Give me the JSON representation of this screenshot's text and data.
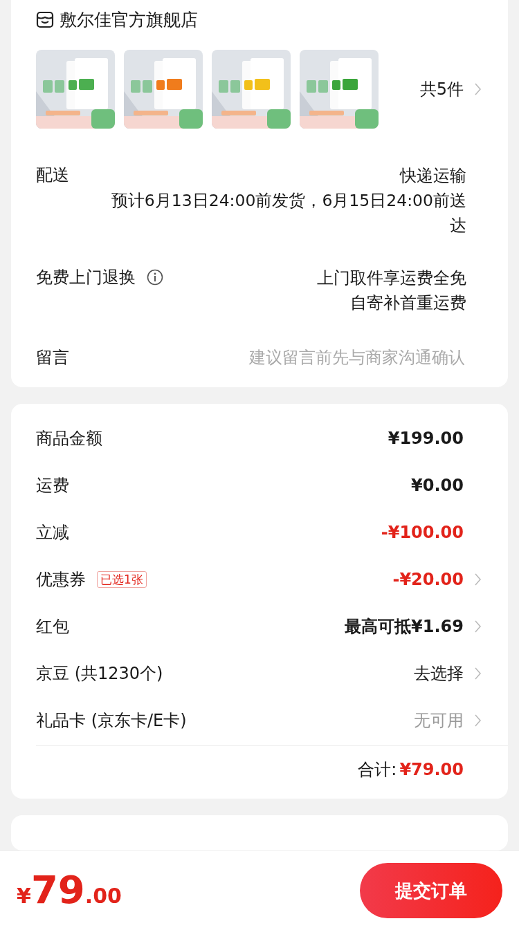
{
  "store": {
    "name": "敷尔佳官方旗舰店"
  },
  "products": {
    "count": "共5件"
  },
  "details": [
    {
      "label": "配送",
      "info_icon": false,
      "lines": [
        "快递运输",
        "预计6月13日24:00前发货，6月15日24:00前送达"
      ]
    },
    {
      "label": "免费上门退换",
      "info_icon": true,
      "lines": [
        "上门取件享运费全免",
        "自寄补首重运费"
      ]
    }
  ],
  "message": {
    "label": "留言",
    "placeholder": "建议留言前先与商家沟通确认"
  },
  "summary": [
    {
      "label": "商品金额",
      "value": "¥199.00",
      "kind": "strong",
      "arrow": false
    },
    {
      "label": "运费",
      "value": "¥0.00",
      "kind": "strong",
      "arrow": false
    },
    {
      "label": "立减",
      "value": "-¥100.00",
      "kind": "red",
      "arrow": false
    },
    {
      "label": "优惠券",
      "tag": "已选1张",
      "value": "-¥20.00",
      "kind": "red",
      "arrow": true
    },
    {
      "label": "红包",
      "value": "最高可抵¥1.69",
      "kind": "strong",
      "arrow": true
    },
    {
      "label": "京豆 (共1230个)",
      "value": "去选择",
      "kind": "normal",
      "arrow": true
    },
    {
      "label": "礼品卡 (京东卡/E卡)",
      "value": "无可用",
      "kind": "muted",
      "arrow": true
    }
  ],
  "total": {
    "label": "合计:",
    "value": "¥79.00"
  },
  "bottom_bar": {
    "currency": "¥",
    "integer": "79",
    "decimal": ".00",
    "submit": "提交订单"
  }
}
